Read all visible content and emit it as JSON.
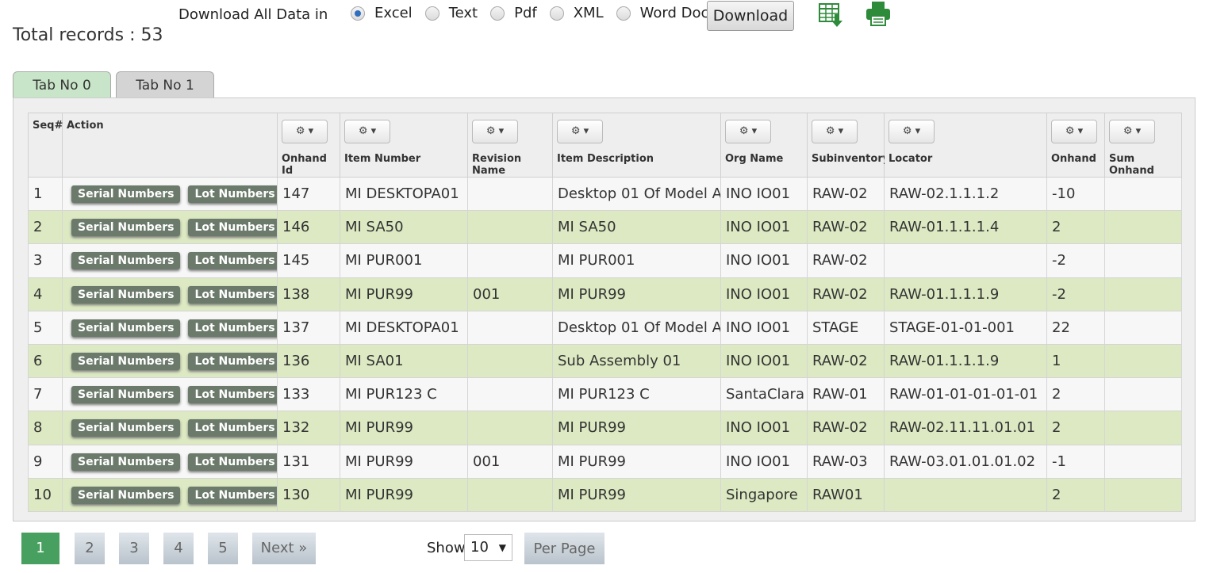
{
  "header": {
    "total_records": "Total records : 53",
    "download_label": "Download All Data in",
    "formats": [
      "Excel",
      "Text",
      "Pdf",
      "XML",
      "Word Doc"
    ],
    "selected_format": "Excel",
    "download_button": "Download",
    "excel_icon": "spreadsheet-download-icon",
    "print_icon": "printer-icon"
  },
  "tabs": [
    {
      "label": "Tab No 0",
      "active": true
    },
    {
      "label": "Tab No 1",
      "active": false
    }
  ],
  "table": {
    "columns": [
      "Seq#",
      "Action",
      "Onhand Id",
      "Item Number",
      "Revision Name",
      "Item Description",
      "Org Name",
      "Subinventory",
      "Locator",
      "Onhand",
      "Sum Onhand"
    ],
    "column_menu_glyph": "⚙ ▾",
    "action_buttons": [
      "Serial Numbers",
      "Lot Numbers"
    ],
    "rows": [
      {
        "seq": "1",
        "onhand_id": "147",
        "item_number": "MI DESKTOPA01",
        "revision": "",
        "description": "Desktop 01 Of Model A",
        "org": "INO IO01",
        "subinventory": "RAW-02",
        "locator": "RAW-02.1.1.1.2",
        "onhand": "-10",
        "sum_onhand": ""
      },
      {
        "seq": "2",
        "onhand_id": "146",
        "item_number": "MI SA50",
        "revision": "",
        "description": "MI SA50",
        "org": "INO IO01",
        "subinventory": "RAW-02",
        "locator": "RAW-01.1.1.1.4",
        "onhand": "2",
        "sum_onhand": ""
      },
      {
        "seq": "3",
        "onhand_id": "145",
        "item_number": "MI PUR001",
        "revision": "",
        "description": "MI PUR001",
        "org": "INO IO01",
        "subinventory": "RAW-02",
        "locator": "",
        "onhand": "-2",
        "sum_onhand": ""
      },
      {
        "seq": "4",
        "onhand_id": "138",
        "item_number": "MI PUR99",
        "revision": "001",
        "description": "MI PUR99",
        "org": "INO IO01",
        "subinventory": "RAW-02",
        "locator": "RAW-01.1.1.1.9",
        "onhand": "-2",
        "sum_onhand": ""
      },
      {
        "seq": "5",
        "onhand_id": "137",
        "item_number": "MI DESKTOPA01",
        "revision": "",
        "description": "Desktop 01 Of Model A",
        "org": "INO IO01",
        "subinventory": "STAGE",
        "locator": "STAGE-01-01-001",
        "onhand": "22",
        "sum_onhand": ""
      },
      {
        "seq": "6",
        "onhand_id": "136",
        "item_number": "MI SA01",
        "revision": "",
        "description": "Sub Assembly 01",
        "org": "INO IO01",
        "subinventory": "RAW-02",
        "locator": "RAW-01.1.1.1.9",
        "onhand": "1",
        "sum_onhand": ""
      },
      {
        "seq": "7",
        "onhand_id": "133",
        "item_number": "MI PUR123 C",
        "revision": "",
        "description": "MI PUR123 C",
        "org": "SantaClara",
        "subinventory": "RAW-01",
        "locator": "RAW-01-01-01-01-01",
        "onhand": "2",
        "sum_onhand": ""
      },
      {
        "seq": "8",
        "onhand_id": "132",
        "item_number": "MI PUR99",
        "revision": "",
        "description": "MI PUR99",
        "org": "INO IO01",
        "subinventory": "RAW-02",
        "locator": "RAW-02.11.11.01.01",
        "onhand": "2",
        "sum_onhand": ""
      },
      {
        "seq": "9",
        "onhand_id": "131",
        "item_number": "MI PUR99",
        "revision": "001",
        "description": "MI PUR99",
        "org": "INO IO01",
        "subinventory": "RAW-03",
        "locator": "RAW-03.01.01.01.02",
        "onhand": "-1",
        "sum_onhand": ""
      },
      {
        "seq": "10",
        "onhand_id": "130",
        "item_number": "MI PUR99",
        "revision": "",
        "description": "MI PUR99",
        "org": "Singapore",
        "subinventory": "RAW01",
        "locator": "",
        "onhand": "2",
        "sum_onhand": ""
      }
    ]
  },
  "pagination": {
    "pages": [
      "1",
      "2",
      "3",
      "4",
      "5"
    ],
    "current_page": "1",
    "next_label": "Next »",
    "show_label": "Show",
    "per_page_value": "10",
    "per_page_button": "Per Page"
  },
  "colors": {
    "active_page": "#47a05f",
    "even_row": "#dce9c2",
    "active_tab": "#c9e5c9",
    "action_button": "#6b7a6b"
  }
}
